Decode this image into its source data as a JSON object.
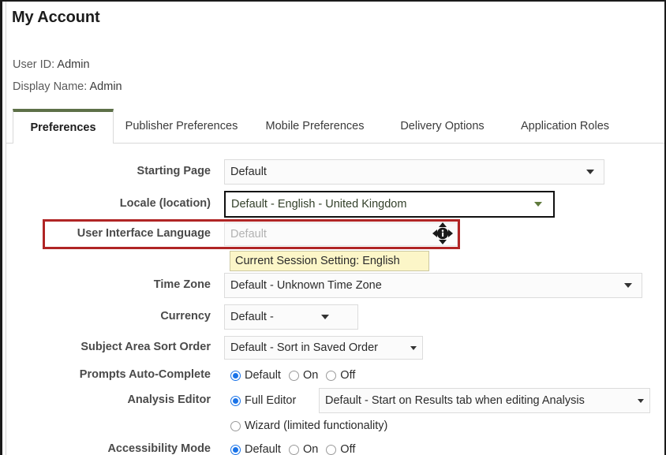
{
  "header": {
    "title": "My Account",
    "user_id_label": "User ID:",
    "user_id_value": "Admin",
    "display_name_label": "Display Name:",
    "display_name_value": "Admin"
  },
  "tabs": [
    {
      "label": "Preferences",
      "active": true
    },
    {
      "label": "Publisher Preferences",
      "active": false
    },
    {
      "label": "Mobile Preferences",
      "active": false
    },
    {
      "label": "Delivery Options",
      "active": false
    },
    {
      "label": "Application Roles",
      "active": false
    }
  ],
  "fields": {
    "starting_page": {
      "label": "Starting Page",
      "value": "Default"
    },
    "locale": {
      "label": "Locale (location)",
      "value": "Default - English - United Kingdom"
    },
    "ui_language": {
      "label": "User Interface Language",
      "value": "Default"
    },
    "session_note": "Current Session Setting: English",
    "time_zone": {
      "label": "Time Zone",
      "value": "Default - Unknown Time Zone"
    },
    "currency": {
      "label": "Currency",
      "value": "Default -"
    },
    "subject_area_sort_order": {
      "label": "Subject Area Sort Order",
      "value": "Default - Sort in Saved Order"
    },
    "prompts_auto_complete": {
      "label": "Prompts Auto-Complete",
      "options": [
        {
          "label": "Default",
          "selected": true
        },
        {
          "label": "On",
          "selected": false
        },
        {
          "label": "Off",
          "selected": false
        }
      ]
    },
    "analysis_editor": {
      "label": "Analysis Editor",
      "full_editor_option": {
        "label": "Full Editor",
        "selected": true
      },
      "full_editor_value": "Default - Start on Results tab when editing Analysis",
      "wizard_option": {
        "label": "Wizard (limited functionality)",
        "selected": false
      }
    },
    "accessibility_mode": {
      "label": "Accessibility Mode",
      "options": [
        {
          "label": "Default",
          "selected": true
        },
        {
          "label": "On",
          "selected": false
        },
        {
          "label": "Off",
          "selected": false
        }
      ]
    }
  },
  "annotations": {
    "ui_language_highlight_color": "#b02525",
    "active_tab_accent_color": "#5d7048",
    "radio_selected_color": "#1a73e8",
    "session_note_background": "#fcf6c8",
    "cursor_icon": "move-cursor-info-icon"
  }
}
